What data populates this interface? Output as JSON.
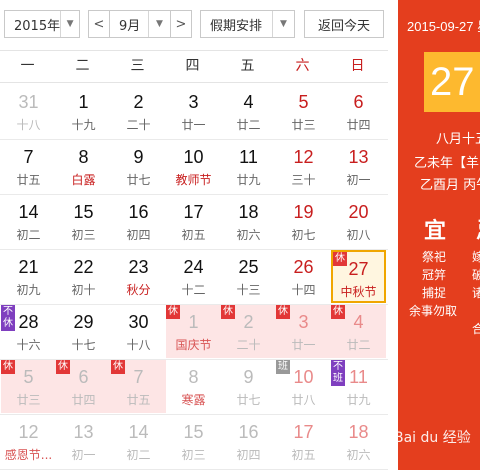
{
  "toolbar": {
    "year": "2015年",
    "month": "9月",
    "prev": "<",
    "next": ">",
    "holiday": "假期安排",
    "today": "返回今天"
  },
  "weekdays": [
    "一",
    "二",
    "三",
    "四",
    "五",
    "六",
    "日"
  ],
  "weeks": [
    [
      {
        "d": "31",
        "l": "十八",
        "other": true
      },
      {
        "d": "1",
        "l": "十九"
      },
      {
        "d": "2",
        "l": "二十"
      },
      {
        "d": "3",
        "l": "廿一"
      },
      {
        "d": "4",
        "l": "廿二"
      },
      {
        "d": "5",
        "l": "廿三"
      },
      {
        "d": "6",
        "l": "廿四"
      }
    ],
    [
      {
        "d": "7",
        "l": "廿五"
      },
      {
        "d": "8",
        "l": "白露",
        "f": true
      },
      {
        "d": "9",
        "l": "廿七"
      },
      {
        "d": "10",
        "l": "教师节",
        "f": true
      },
      {
        "d": "11",
        "l": "廿九"
      },
      {
        "d": "12",
        "l": "三十"
      },
      {
        "d": "13",
        "l": "初一"
      }
    ],
    [
      {
        "d": "14",
        "l": "初二"
      },
      {
        "d": "15",
        "l": "初三"
      },
      {
        "d": "16",
        "l": "初四"
      },
      {
        "d": "17",
        "l": "初五"
      },
      {
        "d": "18",
        "l": "初六"
      },
      {
        "d": "19",
        "l": "初七"
      },
      {
        "d": "20",
        "l": "初八"
      }
    ],
    [
      {
        "d": "21",
        "l": "初九"
      },
      {
        "d": "22",
        "l": "初十"
      },
      {
        "d": "23",
        "l": "秋分",
        "f": true
      },
      {
        "d": "24",
        "l": "十二"
      },
      {
        "d": "25",
        "l": "十三"
      },
      {
        "d": "26",
        "l": "十四"
      },
      {
        "d": "27",
        "l": "中秋节",
        "f": true,
        "badge": "休",
        "sel": true
      }
    ],
    [
      {
        "d": "28",
        "l": "十六",
        "badge": "不休",
        "purple": true
      },
      {
        "d": "29",
        "l": "十七"
      },
      {
        "d": "30",
        "l": "十八"
      },
      {
        "d": "1",
        "l": "国庆节",
        "f": true,
        "badge": "休",
        "hol": true,
        "other": true
      },
      {
        "d": "2",
        "l": "二十",
        "badge": "休",
        "hol": true,
        "other": true
      },
      {
        "d": "3",
        "l": "廿一",
        "badge": "休",
        "hol": true,
        "other": true
      },
      {
        "d": "4",
        "l": "廿二",
        "badge": "休",
        "hol": true,
        "other": true
      }
    ],
    [
      {
        "d": "5",
        "l": "廿三",
        "badge": "休",
        "hol": true,
        "other": true
      },
      {
        "d": "6",
        "l": "廿四",
        "badge": "休",
        "hol": true,
        "other": true
      },
      {
        "d": "7",
        "l": "廿五",
        "badge": "休",
        "hol": true,
        "other": true
      },
      {
        "d": "8",
        "l": "寒露",
        "f": true,
        "other": true
      },
      {
        "d": "9",
        "l": "廿七",
        "other": true
      },
      {
        "d": "10",
        "l": "廿八",
        "badge": "班",
        "ban": true,
        "other": true
      },
      {
        "d": "11",
        "l": "廿九",
        "badge": "不班",
        "purple": true,
        "other": true
      }
    ],
    [
      {
        "d": "12",
        "l": "感恩节...",
        "f": true,
        "other": true
      },
      {
        "d": "13",
        "l": "初一",
        "other": true
      },
      {
        "d": "14",
        "l": "初二",
        "other": true
      },
      {
        "d": "15",
        "l": "初三",
        "other": true
      },
      {
        "d": "16",
        "l": "初四",
        "other": true
      },
      {
        "d": "17",
        "l": "初五",
        "other": true
      },
      {
        "d": "18",
        "l": "初六",
        "other": true
      }
    ]
  ],
  "panel": {
    "date": "2015-09-27 星",
    "day": "27",
    "lunar": "八月十五",
    "ganzhi_year": "乙未年【羊",
    "ganzhi_month": "乙酉月 丙午",
    "yi": "宜",
    "ji": "忌",
    "yi_items": [
      "祭祀",
      "冠笄",
      "捕捉",
      "余事勿取"
    ],
    "ji_items": [
      "嫁",
      "破",
      "诸",
      "合"
    ]
  },
  "watermark": "Bai du 经验",
  "colors": {
    "accent_red": "#e43e1e",
    "weekend_red": "#c81e1e",
    "today_yellow": "#fdb92f",
    "holiday_pink": "#fde5e5"
  }
}
